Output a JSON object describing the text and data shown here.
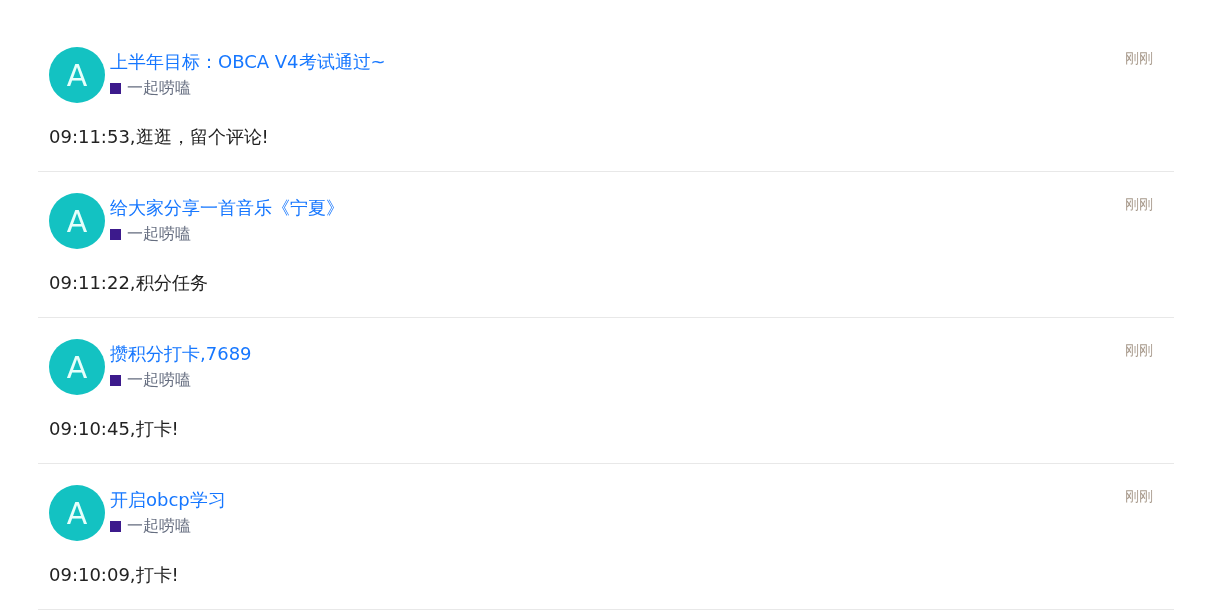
{
  "posts": [
    {
      "avatar": "A",
      "title": "上半年目标：OBCA V4考试通过~",
      "category": "一起唠嗑",
      "time": "刚刚",
      "body": "09:11:53,逛逛，留个评论!"
    },
    {
      "avatar": "A",
      "title": "给大家分享一首音乐《宁夏》",
      "category": "一起唠嗑",
      "time": "刚刚",
      "body": "09:11:22,积分任务"
    },
    {
      "avatar": "A",
      "title": "攒积分打卡,7689",
      "category": "一起唠嗑",
      "time": "刚刚",
      "body": "09:10:45,打卡!"
    },
    {
      "avatar": "A",
      "title": "开启obcp学习",
      "category": "一起唠嗑",
      "time": "刚刚",
      "body": "09:10:09,打卡!"
    }
  ]
}
